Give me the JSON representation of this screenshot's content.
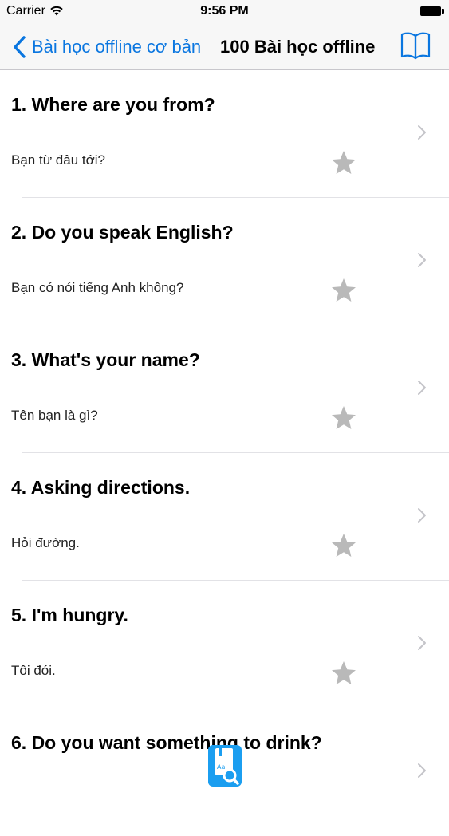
{
  "status_bar": {
    "carrier": "Carrier",
    "time": "9:56 PM"
  },
  "nav": {
    "back_label": "Bài học offline cơ bản",
    "title": "100 Bài học offline",
    "book_icon": "book-icon"
  },
  "lessons": [
    {
      "title": "1. Where are you from?",
      "subtitle": "Bạn từ đâu tới?"
    },
    {
      "title": "2. Do you speak English?",
      "subtitle": "Bạn có nói tiếng Anh không?"
    },
    {
      "title": "3. What's your name?",
      "subtitle": "Tên bạn là gì?"
    },
    {
      "title": "4. Asking directions.",
      "subtitle": "Hỏi đường."
    },
    {
      "title": "5. I'm hungry.",
      "subtitle": "Tôi đói."
    },
    {
      "title": "6. Do you want something to drink?",
      "subtitle": ""
    }
  ],
  "colors": {
    "accent": "#0a76e0",
    "star": "#b9b9b9",
    "chevron": "#c4c4c9",
    "icon_bg": "#1b9ef0"
  }
}
